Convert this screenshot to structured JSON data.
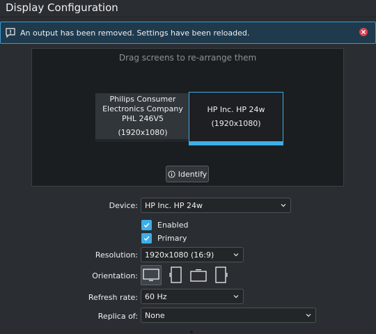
{
  "window": {
    "title": "Display Configuration"
  },
  "banner": {
    "message": "An output has been removed. Settings have been reloaded.",
    "icon": "warning-speech-icon",
    "close_icon": "close-icon",
    "accent": "#3a9ad6"
  },
  "arrangement": {
    "hint": "Drag screens to re-arrange them",
    "monitors": [
      {
        "name": "Philips Consumer Electronics Company PHL 246V5",
        "resolution": "(1920x1080)",
        "selected": false
      },
      {
        "name": "HP Inc. HP 24w",
        "resolution": "(1920x1080)",
        "selected": true
      }
    ],
    "identify_label": "Identify",
    "identify_icon": "info-icon"
  },
  "settings": {
    "device_label": "Device:",
    "device_value": "HP Inc. HP 24w",
    "enabled_label": "Enabled",
    "enabled_checked": true,
    "primary_label": "Primary",
    "primary_checked": true,
    "resolution_label": "Resolution:",
    "resolution_value": "1920x1080 (16:9)",
    "orientation_label": "Orientation:",
    "orientation_options": [
      {
        "icon": "landscape-monitor-icon",
        "selected": true
      },
      {
        "icon": "portrait-monitor-icon",
        "selected": false
      },
      {
        "icon": "landscape-flipped-monitor-icon",
        "selected": false
      },
      {
        "icon": "portrait-flipped-monitor-icon",
        "selected": false
      }
    ],
    "refresh_label": "Refresh rate:",
    "refresh_value": "60 Hz",
    "replica_label": "Replica of:",
    "replica_value": "None"
  },
  "colors": {
    "accent": "#3daee9",
    "background": "#2a2e32",
    "error": "#da4453"
  }
}
